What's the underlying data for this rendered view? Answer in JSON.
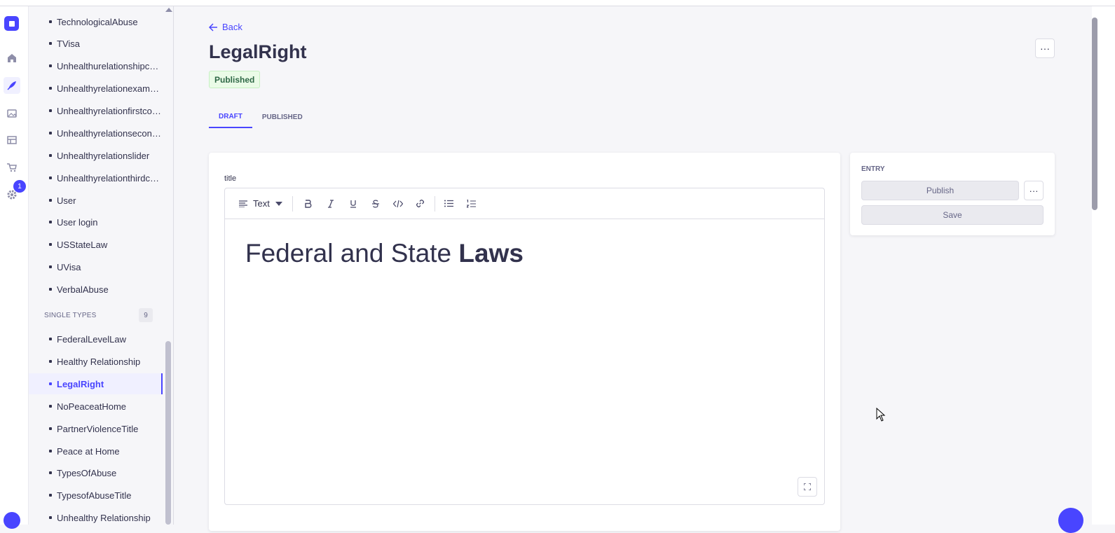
{
  "rail": {
    "badge_count": "1",
    "items": [
      "home-icon",
      "content-manager-icon",
      "media-library-icon",
      "content-type-builder-icon",
      "marketplace-icon",
      "settings-icon"
    ]
  },
  "sidebar": {
    "collection_items": [
      "TechnologicalAbuse",
      "TVisa",
      "Unhealthurelationshipcon...",
      "Unhealthyrelationexample",
      "Unhealthyrelationfirstcon...",
      "Unhealthyrelationsecond...",
      "Unhealthyrelationslider",
      "Unhealthyrelationthirdco...",
      "User",
      "User login",
      "USStateLaw",
      "UVisa",
      "VerbalAbuse"
    ],
    "single_types_label": "SINGLE TYPES",
    "single_types_count": "9",
    "single_items": [
      "FederalLevelLaw",
      "Healthy Relationship",
      "LegalRight",
      "NoPeaceatHome",
      "PartnerViolenceTitle",
      "Peace at Home",
      "TypesOfAbuse",
      "TypesofAbuseTitle",
      "Unhealthy Relationship"
    ]
  },
  "header": {
    "back_label": "Back",
    "title": "LegalRight",
    "status": "Published"
  },
  "tabs": [
    "DRAFT",
    "PUBLISHED"
  ],
  "editor": {
    "field_label": "title",
    "block_type": "Text",
    "content_plain": "Federal and State ",
    "content_bold": "Laws"
  },
  "entry": {
    "label": "ENTRY",
    "publish_label": "Publish",
    "more_label": "···",
    "save_label": "Save"
  },
  "more_label": "···",
  "colors": {
    "accent": "#4945ff",
    "published_bg": "#eafbe7",
    "published_text": "#2f6846"
  }
}
